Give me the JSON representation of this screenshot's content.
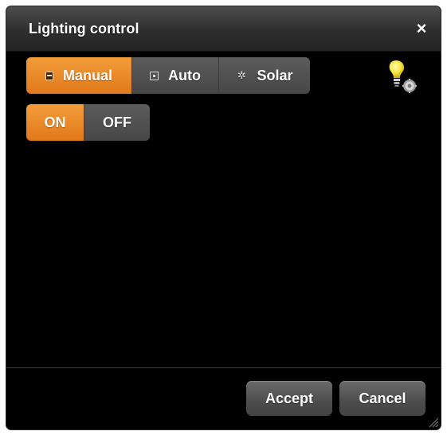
{
  "dialog": {
    "title": "Lighting control",
    "close_label": "×"
  },
  "mode": {
    "options": [
      {
        "label": "Manual",
        "icon": "manual-icon",
        "selected": true
      },
      {
        "label": "Auto",
        "icon": "calendar-icon",
        "selected": false
      },
      {
        "label": "Solar",
        "icon": "sun-icon",
        "selected": false
      }
    ],
    "solar_glyph": "✲"
  },
  "power": {
    "on_label": "ON",
    "off_label": "OFF",
    "selected": "ON"
  },
  "status_icon": "lightbulb-settings-icon",
  "footer": {
    "accept_label": "Accept",
    "cancel_label": "Cancel"
  },
  "colors": {
    "accent": "#e8852a",
    "background": "#000000",
    "button": "#555555",
    "bulb": "#f7e53b"
  }
}
